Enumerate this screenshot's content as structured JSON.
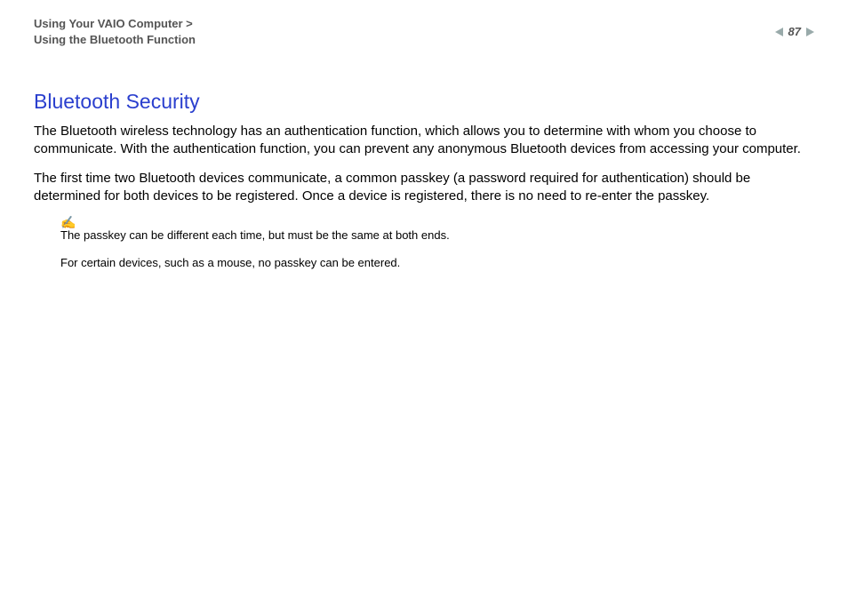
{
  "header": {
    "breadcrumb_line1": "Using Your VAIO Computer >",
    "breadcrumb_line2": "Using the Bluetooth Function",
    "page_number": "87"
  },
  "content": {
    "title": "Bluetooth Security",
    "para1": "The Bluetooth wireless technology has an authentication function, which allows you to determine with whom you choose to communicate. With the authentication function, you can prevent any anonymous Bluetooth devices from accessing your computer.",
    "para2": "The first time two Bluetooth devices communicate, a common passkey (a password required for authentication) should be determined for both devices to be registered. Once a device is registered, there is no need to re-enter the passkey.",
    "note_icon": "✍",
    "note1": "The passkey can be different each time, but must be the same at both ends.",
    "note2": "For certain devices, such as a mouse, no passkey can be entered."
  }
}
